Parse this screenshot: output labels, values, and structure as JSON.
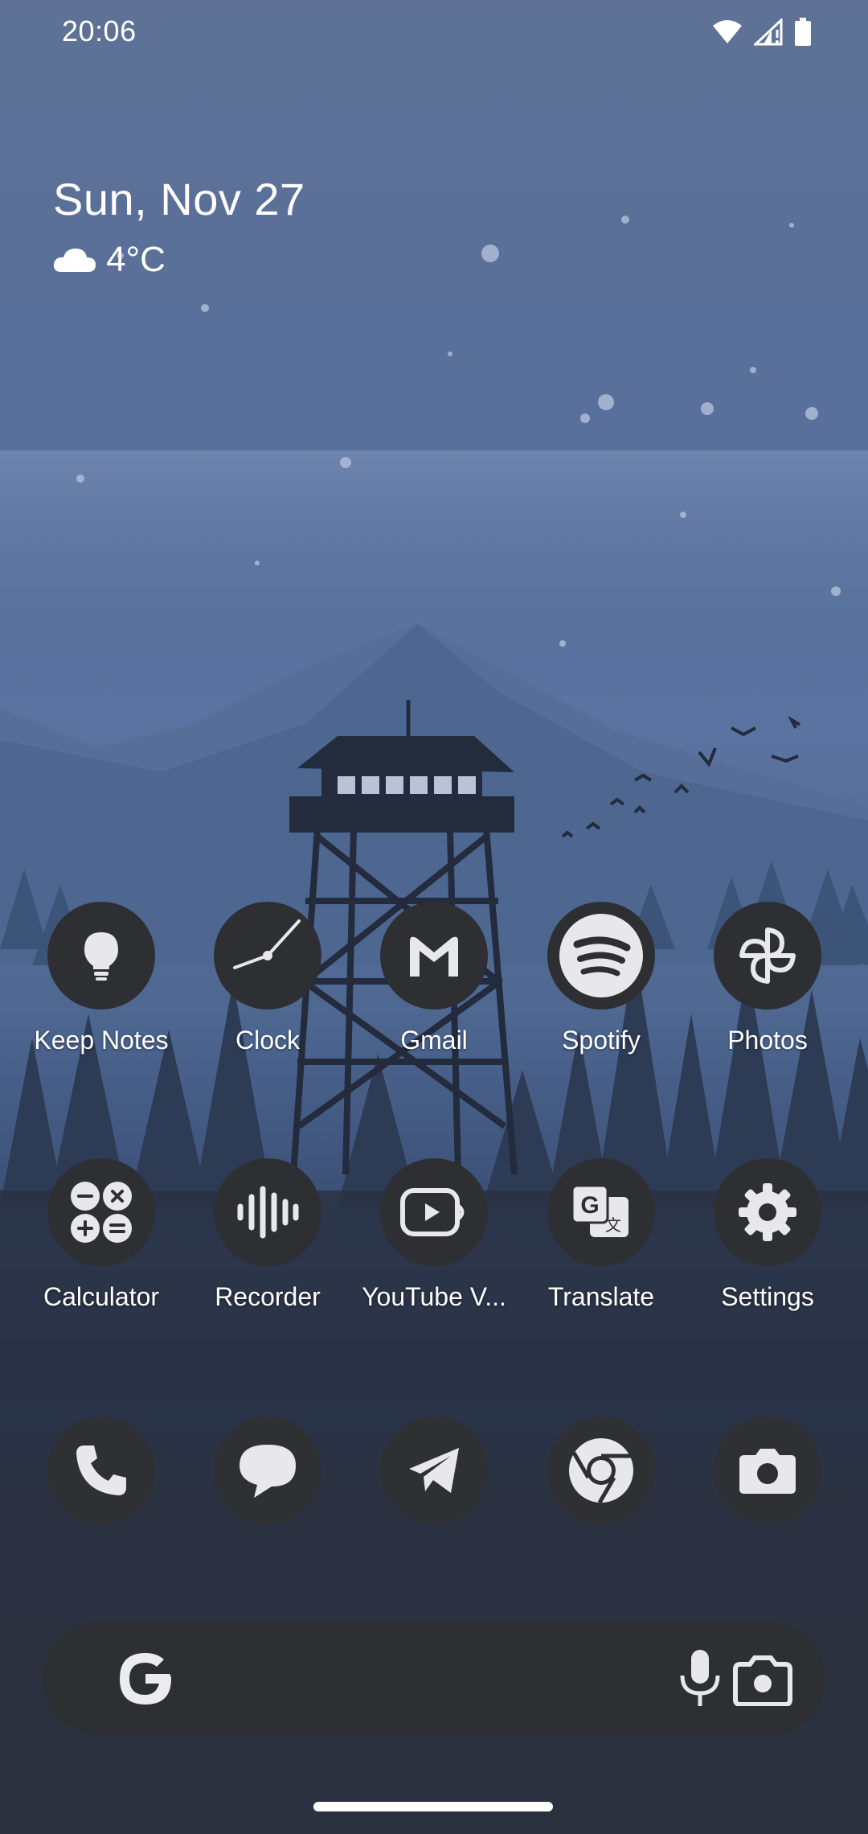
{
  "status_bar": {
    "time": "20:06",
    "icons": [
      "wifi-icon",
      "cellular-signal-icon",
      "battery-icon"
    ]
  },
  "glance": {
    "date": "Sun, Nov 27",
    "weather_icon": "cloud-icon",
    "temperature": "4°C"
  },
  "apps_row1": [
    {
      "label": "Keep Notes",
      "icon": "lightbulb-icon"
    },
    {
      "label": "Clock",
      "icon": "clock-icon"
    },
    {
      "label": "Gmail",
      "icon": "gmail-icon"
    },
    {
      "label": "Spotify",
      "icon": "spotify-icon"
    },
    {
      "label": "Photos",
      "icon": "pinwheel-icon"
    }
  ],
  "apps_row2": [
    {
      "label": "Calculator",
      "icon": "calculator-icon"
    },
    {
      "label": "Recorder",
      "icon": "waveform-icon"
    },
    {
      "label": "YouTube V...",
      "icon": "youtube-vanced-icon"
    },
    {
      "label": "Translate",
      "icon": "translate-icon"
    },
    {
      "label": "Settings",
      "icon": "gear-icon"
    }
  ],
  "dock": [
    {
      "icon": "phone-icon"
    },
    {
      "icon": "messages-icon"
    },
    {
      "icon": "telegram-icon"
    },
    {
      "icon": "chrome-icon"
    },
    {
      "icon": "camera-icon"
    }
  ],
  "search_bar": {
    "icons": [
      "google-g-icon",
      "microphone-icon",
      "lens-icon"
    ]
  },
  "colors": {
    "icon_circle": "#2e2f33",
    "icon_glyph": "#e6e6ea",
    "text": "#ffffff"
  }
}
